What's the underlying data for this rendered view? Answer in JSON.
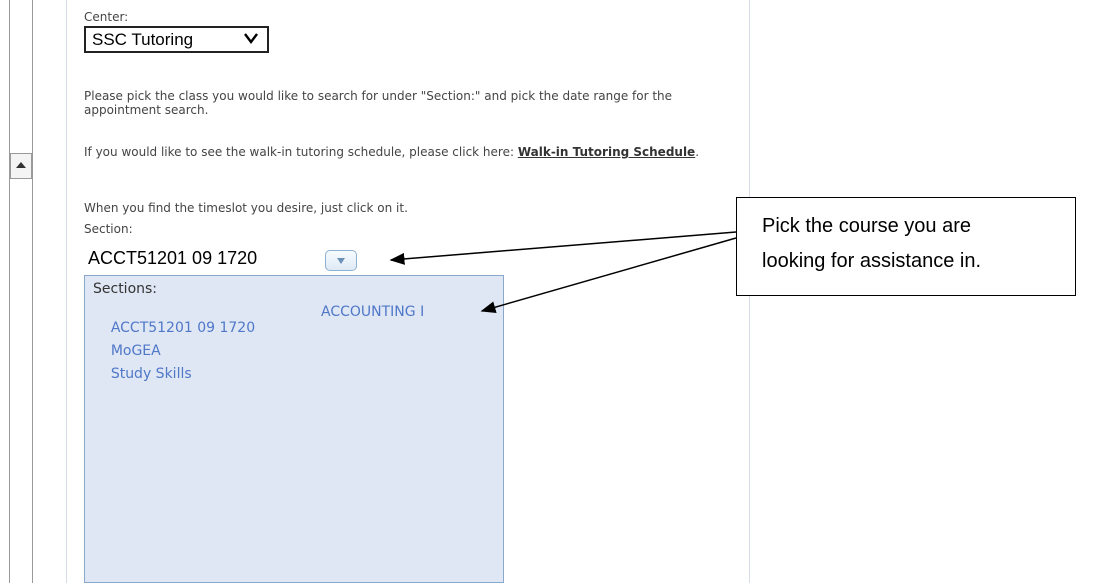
{
  "center": {
    "label": "Center:",
    "selected": "SSC Tutoring"
  },
  "instructions": {
    "p1": "Please pick the class you would like to search for under \"Section:\" and pick the date range for the appointment search.",
    "p2_prefix": "If you would like to see the walk-in tutoring schedule, please click here: ",
    "p2_link": "Walk-in Tutoring Schedule",
    "p2_suffix": ".",
    "p3": "When you find the timeslot you desire, just click on it."
  },
  "section": {
    "label": "Section:",
    "value": "ACCT51201 09 1720",
    "dropdown": {
      "header": "Sections:",
      "items": [
        {
          "code": "ACCT51201 09 1720",
          "title": "ACCOUNTING I"
        },
        {
          "code": "MoGEA",
          "title": ""
        },
        {
          "code": "Study Skills",
          "title": ""
        }
      ]
    }
  },
  "callout": {
    "line1": "Pick the course you are",
    "line2": "looking for assistance in."
  },
  "icons": {
    "scroll_up": "scroll-up-arrow-icon",
    "select_chevron": "chevron-down-icon",
    "dropdown_toggle": "dropdown-arrow-icon"
  },
  "colors": {
    "link_blue": "#4f78c8",
    "list_bg": "#dfe6f4",
    "list_border": "#8aa8cc"
  }
}
